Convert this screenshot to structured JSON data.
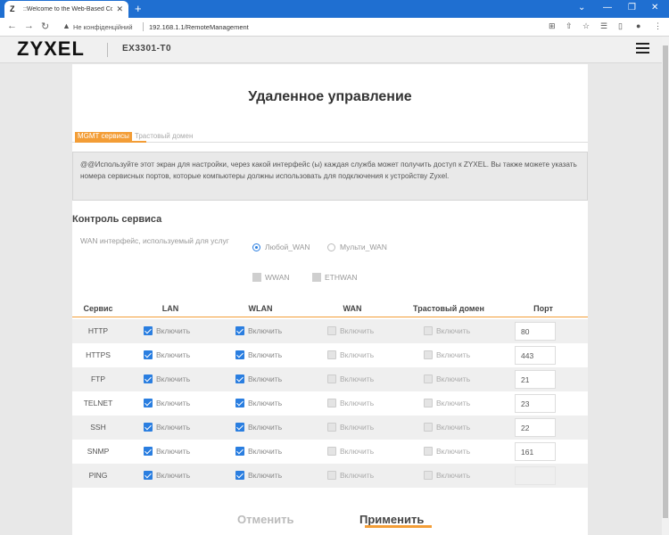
{
  "browser": {
    "tab_title": "::Welcome to the Web-Based Co",
    "favicon": "Z",
    "not_secure": "Не конфіденційний",
    "url": "192.168.1.1/RemoteManagement"
  },
  "header": {
    "logo": "ZYXEL",
    "model": "EX3301-T0"
  },
  "page": {
    "title": "Удаленное управление",
    "tabs": [
      "MGMT сервисы",
      "Трастовый домен"
    ],
    "info": "@@Используйте этот экран для настройки, через какой интерфейс (ы) каждая служба может получить доступ к ZYXEL. Вы также можете указать номера сервисных портов, которые компьютеры должны использовать для подключения к устройству Zyxel.",
    "section_title": "Контроль сервиса",
    "wan_label": "WAN интерфейс, используемый для услуг",
    "radio_any": "Любой_WAN",
    "radio_multi": "Мульти_WAN",
    "chk_wwan": "WWAN",
    "chk_ethwan": "ETHWAN"
  },
  "table": {
    "headers": {
      "service": "Сервис",
      "lan": "LAN",
      "wlan": "WLAN",
      "wan": "WAN",
      "trust": "Трастовый домен",
      "port": "Порт"
    },
    "enable_label": "Включить",
    "rows": [
      {
        "service": "HTTP",
        "port": "80"
      },
      {
        "service": "HTTPS",
        "port": "443"
      },
      {
        "service": "FTP",
        "port": "21"
      },
      {
        "service": "TELNET",
        "port": "23"
      },
      {
        "service": "SSH",
        "port": "22"
      },
      {
        "service": "SNMP",
        "port": "161"
      },
      {
        "service": "PING",
        "port": ""
      }
    ]
  },
  "buttons": {
    "cancel": "Отменить",
    "apply": "Применить"
  },
  "colors": {
    "accent": "#f39d36",
    "checkbox": "#2a7ee0",
    "browser_bar": "#1f6fd1"
  }
}
